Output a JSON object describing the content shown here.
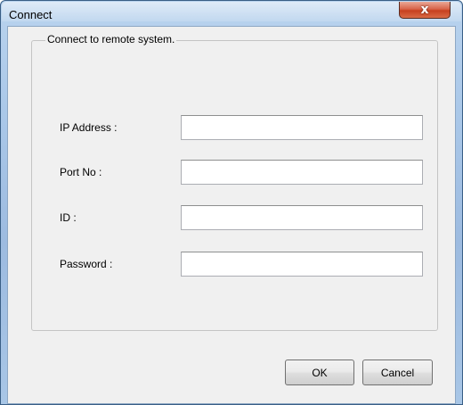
{
  "window": {
    "title": "Connect",
    "close_glyph": "x"
  },
  "group": {
    "label": "Connect to remote system."
  },
  "fields": [
    {
      "label": "IP Address :",
      "value": ""
    },
    {
      "label": "Port No :",
      "value": ""
    },
    {
      "label": "ID :",
      "value": ""
    },
    {
      "label": "Password :",
      "value": ""
    }
  ],
  "buttons": {
    "ok": "OK",
    "cancel": "Cancel"
  },
  "icons": {
    "close": "close-icon"
  },
  "colors": {
    "title_frame": "#a9c7e8",
    "close_button": "#c7401f",
    "client_bg": "#f0f0f0"
  }
}
